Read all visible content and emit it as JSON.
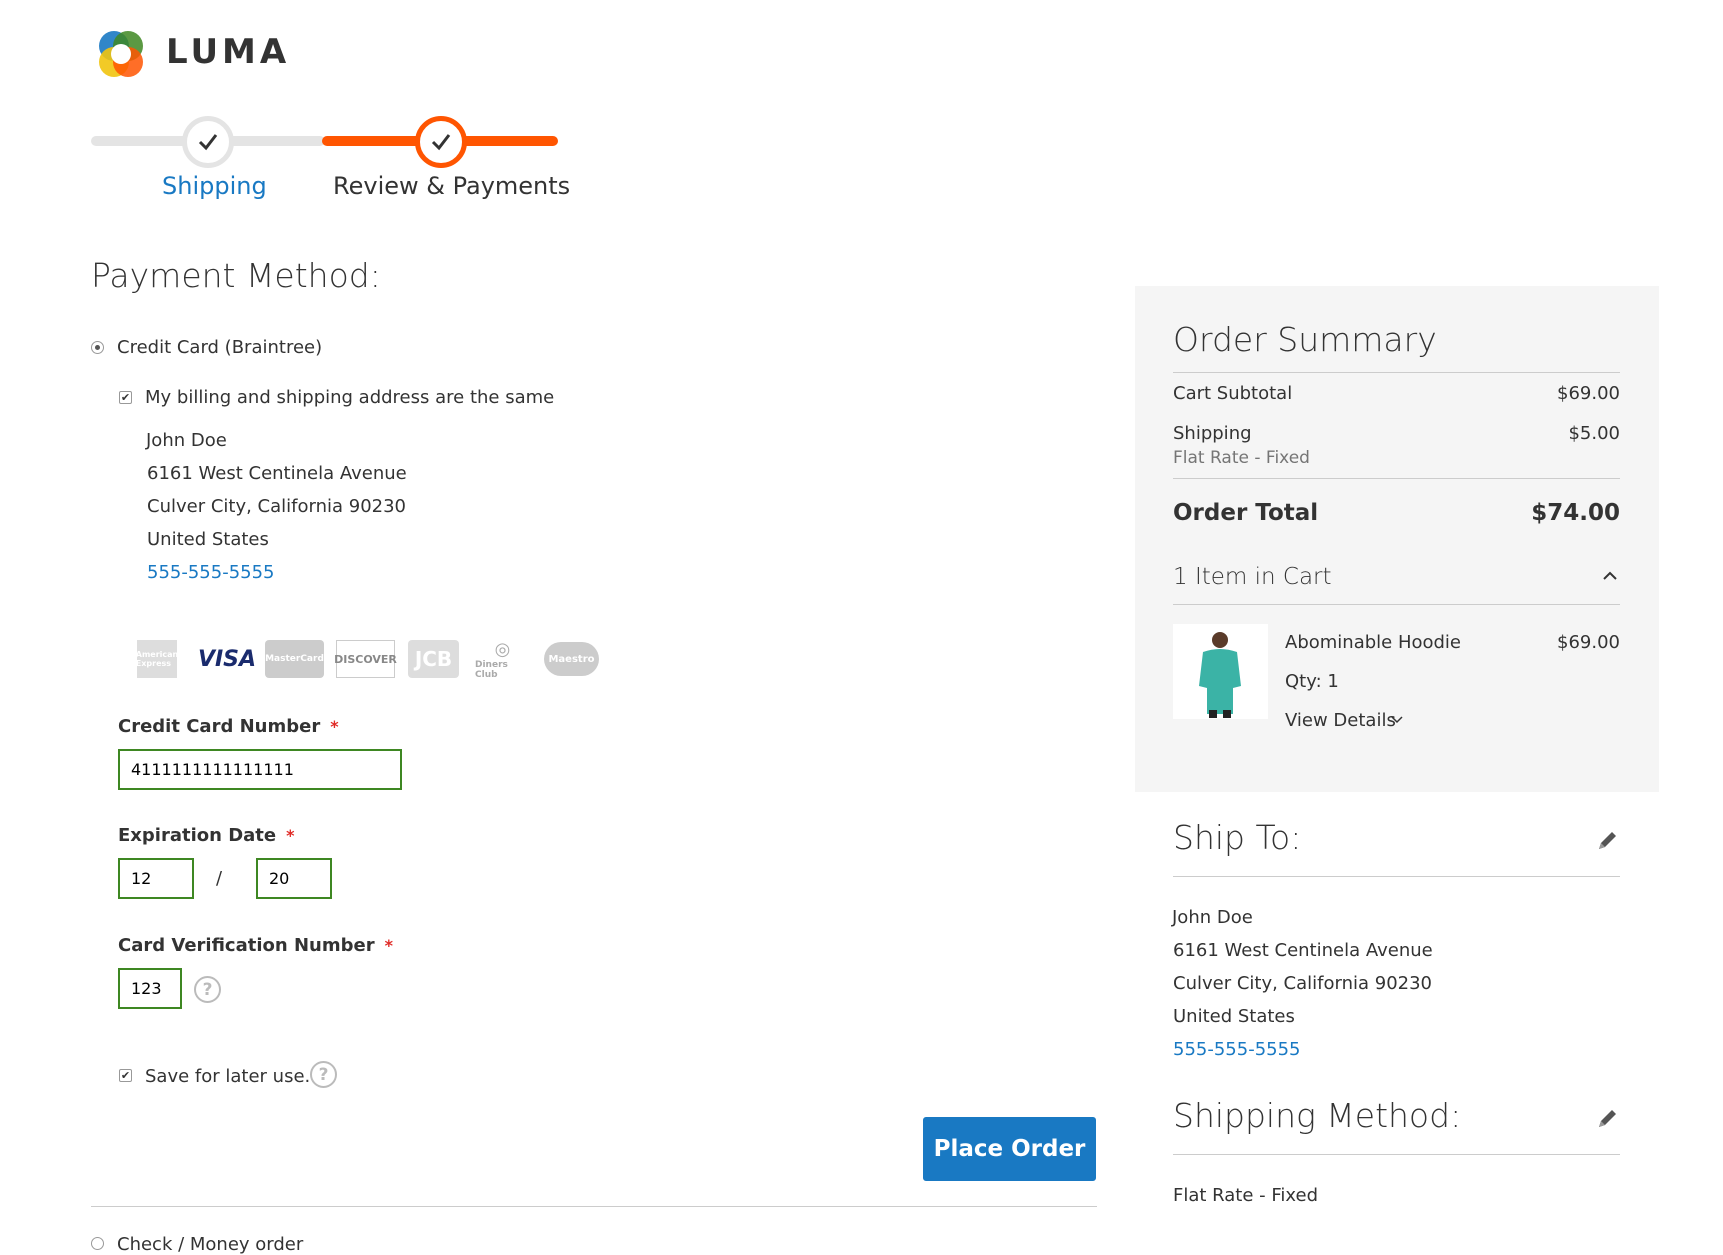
{
  "header": {
    "brand": "LUMA"
  },
  "progress": {
    "steps": [
      {
        "label": "Shipping",
        "state": "complete"
      },
      {
        "label": "Review & Payments",
        "state": "active"
      }
    ]
  },
  "payment": {
    "title": "Payment Method:",
    "methods": [
      {
        "label": "Credit Card (Braintree)",
        "selected": true
      },
      {
        "label": "Check / Money order",
        "selected": false
      }
    ],
    "same_address_label": "My billing and shipping address are the same",
    "billing_address": {
      "name": "John Doe",
      "street": "6161 West Centinela Avenue",
      "city": "Culver City, California 90230",
      "country": "United States",
      "phone": "555-555-5555"
    },
    "card_types": [
      "American Express",
      "VISA",
      "MasterCard",
      "DISCOVER",
      "JCB",
      "Diners Club",
      "Maestro"
    ],
    "card_number_label": "Credit Card Number",
    "card_number_value": "4111111111111111",
    "expiration_label": "Expiration Date",
    "exp_month": "12",
    "exp_separator": "/",
    "exp_year": "20",
    "cvv_label": "Card Verification Number",
    "cvv_value": "123",
    "save_label": "Save for later use.",
    "required_mark": "*",
    "place_order_label": "Place Order"
  },
  "summary": {
    "title": "Order Summary",
    "subtotal_label": "Cart Subtotal",
    "subtotal_value": "$69.00",
    "shipping_label": "Shipping",
    "shipping_method": "Flat Rate - Fixed",
    "shipping_value": "$5.00",
    "total_label": "Order Total",
    "total_value": "$74.00",
    "items_title": "1 Item in Cart",
    "item": {
      "name": "Abominable Hoodie",
      "price": "$69.00",
      "qty": "Qty: 1",
      "details_label": "View Details"
    }
  },
  "ship_to": {
    "title": "Ship To:",
    "name": "John Doe",
    "street": "6161 West Centinela Avenue",
    "city": "Culver City, California 90230",
    "country": "United States",
    "phone": "555-555-5555"
  },
  "shipping_method": {
    "title": "Shipping Method:",
    "value": "Flat Rate - Fixed"
  },
  "colors": {
    "accent": "#ff5501",
    "link": "#1979c3",
    "button": "#1979c3",
    "summary_bg": "#f5f5f5",
    "required": "#e02b27",
    "input_border": "#3e8722"
  }
}
